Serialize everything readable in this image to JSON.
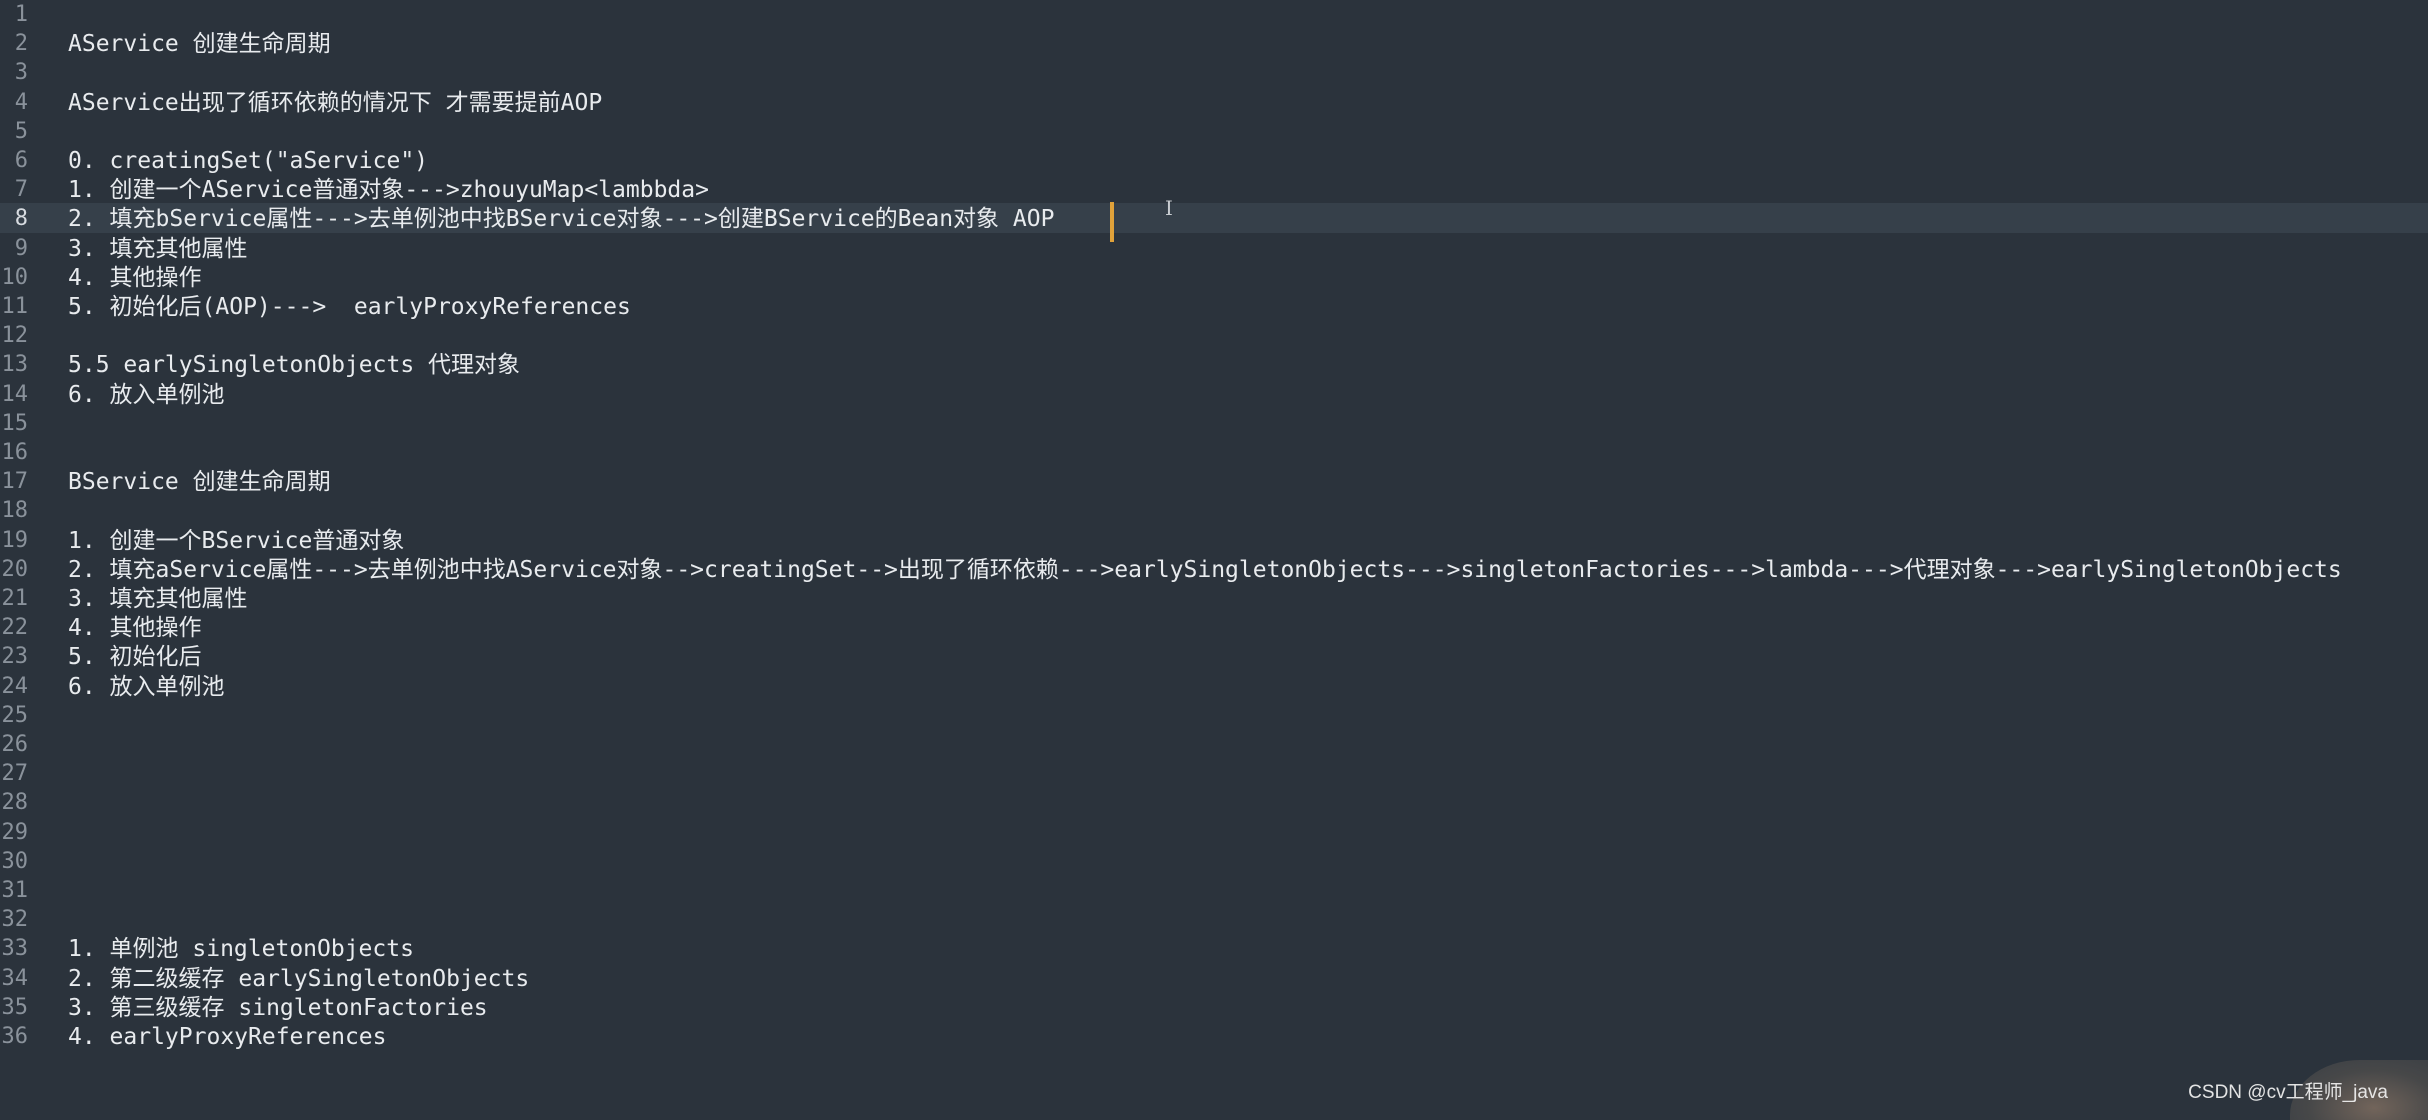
{
  "editor": {
    "active_line": 8,
    "caret_color": "#e0a23a",
    "background": "#2b333c",
    "lines": [
      {
        "n": "1",
        "text": ""
      },
      {
        "n": "2",
        "text": "AService 创建生命周期"
      },
      {
        "n": "3",
        "text": ""
      },
      {
        "n": "4",
        "text": "AService出现了循环依赖的情况下 才需要提前AOP"
      },
      {
        "n": "5",
        "text": ""
      },
      {
        "n": "6",
        "text": "0. creatingSet(\"aService\")"
      },
      {
        "n": "7",
        "text": "1. 创建一个AService普通对象--->zhouyuMap<lambbda>"
      },
      {
        "n": "8",
        "text": "2. 填充bService属性--->去单例池中找BService对象--->创建BService的Bean对象 AOP"
      },
      {
        "n": "9",
        "text": "3. 填充其他属性"
      },
      {
        "n": "10",
        "text": "4. 其他操作"
      },
      {
        "n": "11",
        "text": "5. 初始化后(AOP)--->  earlyProxyReferences"
      },
      {
        "n": "12",
        "text": ""
      },
      {
        "n": "13",
        "text": "5.5 earlySingletonObjects 代理对象"
      },
      {
        "n": "14",
        "text": "6. 放入单例池"
      },
      {
        "n": "15",
        "text": ""
      },
      {
        "n": "16",
        "text": ""
      },
      {
        "n": "17",
        "text": "BService 创建生命周期"
      },
      {
        "n": "18",
        "text": ""
      },
      {
        "n": "19",
        "text": "1. 创建一个BService普通对象"
      },
      {
        "n": "20",
        "text": "2. 填充aService属性--->去单例池中找AService对象-->creatingSet-->出现了循环依赖--->earlySingletonObjects--->singletonFactories--->lambda--->代理对象--->earlySingletonObjects"
      },
      {
        "n": "21",
        "text": "3. 填充其他属性"
      },
      {
        "n": "22",
        "text": "4. 其他操作"
      },
      {
        "n": "23",
        "text": "5. 初始化后"
      },
      {
        "n": "24",
        "text": "6. 放入单例池"
      },
      {
        "n": "25",
        "text": ""
      },
      {
        "n": "26",
        "text": ""
      },
      {
        "n": "27",
        "text": ""
      },
      {
        "n": "28",
        "text": ""
      },
      {
        "n": "29",
        "text": ""
      },
      {
        "n": "30",
        "text": ""
      },
      {
        "n": "31",
        "text": ""
      },
      {
        "n": "32",
        "text": ""
      },
      {
        "n": "33",
        "text": "1. 单例池 singletonObjects"
      },
      {
        "n": "34",
        "text": "2. 第二级缓存 earlySingletonObjects"
      },
      {
        "n": "35",
        "text": "3. 第三级缓存 singletonFactories"
      },
      {
        "n": "36",
        "text": "4. earlyProxyReferences"
      }
    ]
  },
  "watermark": {
    "text": "CSDN @cv工程师_java"
  },
  "cursor_icon": "text-cursor-icon"
}
